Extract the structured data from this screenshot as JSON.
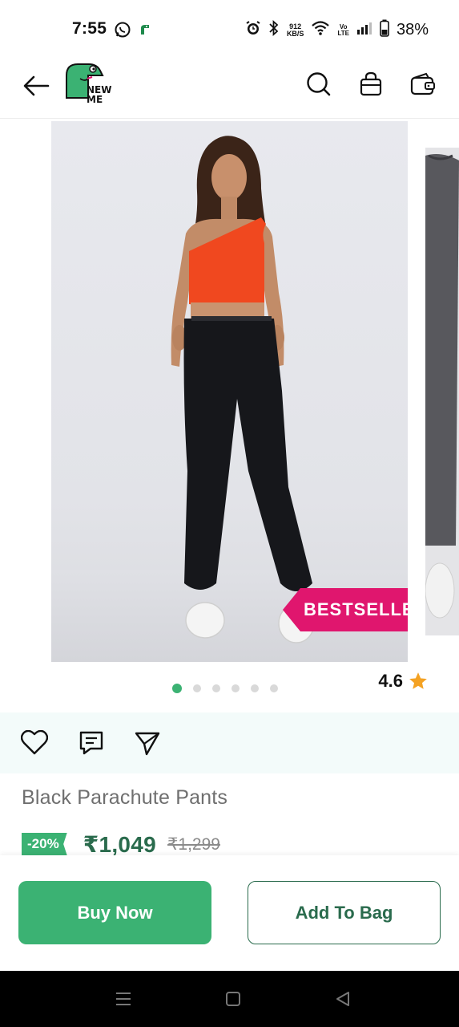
{
  "status_bar": {
    "time": "7:55",
    "network_speed_value": "912",
    "network_speed_unit": "KB/S",
    "volte_top": "Vo",
    "volte_bottom": "LTE",
    "battery": "38%"
  },
  "header": {
    "logo_text_line1": "NEW",
    "logo_text_line2": "ME",
    "icons": [
      "back-arrow-icon",
      "search-icon",
      "shopping-bag-icon",
      "wallet-icon"
    ]
  },
  "carousel": {
    "badge": "BESTSELLER",
    "total_images": 6,
    "active_index": 0
  },
  "rating": {
    "value": "4.6"
  },
  "actions": {
    "icons": [
      "heart-icon",
      "comment-icon",
      "share-icon"
    ]
  },
  "product": {
    "title": "Black Parachute Pants",
    "discount": "-20%",
    "price": "₹1,049",
    "original_price": "₹1,299"
  },
  "buttons": {
    "buy_now": "Buy Now",
    "add_to_bag": "Add To Bag"
  },
  "colors": {
    "brand_green": "#3bb273",
    "dark_green": "#2a6b4d",
    "badge_pink": "#e0166e",
    "action_strip_bg": "#f3fbfa"
  }
}
